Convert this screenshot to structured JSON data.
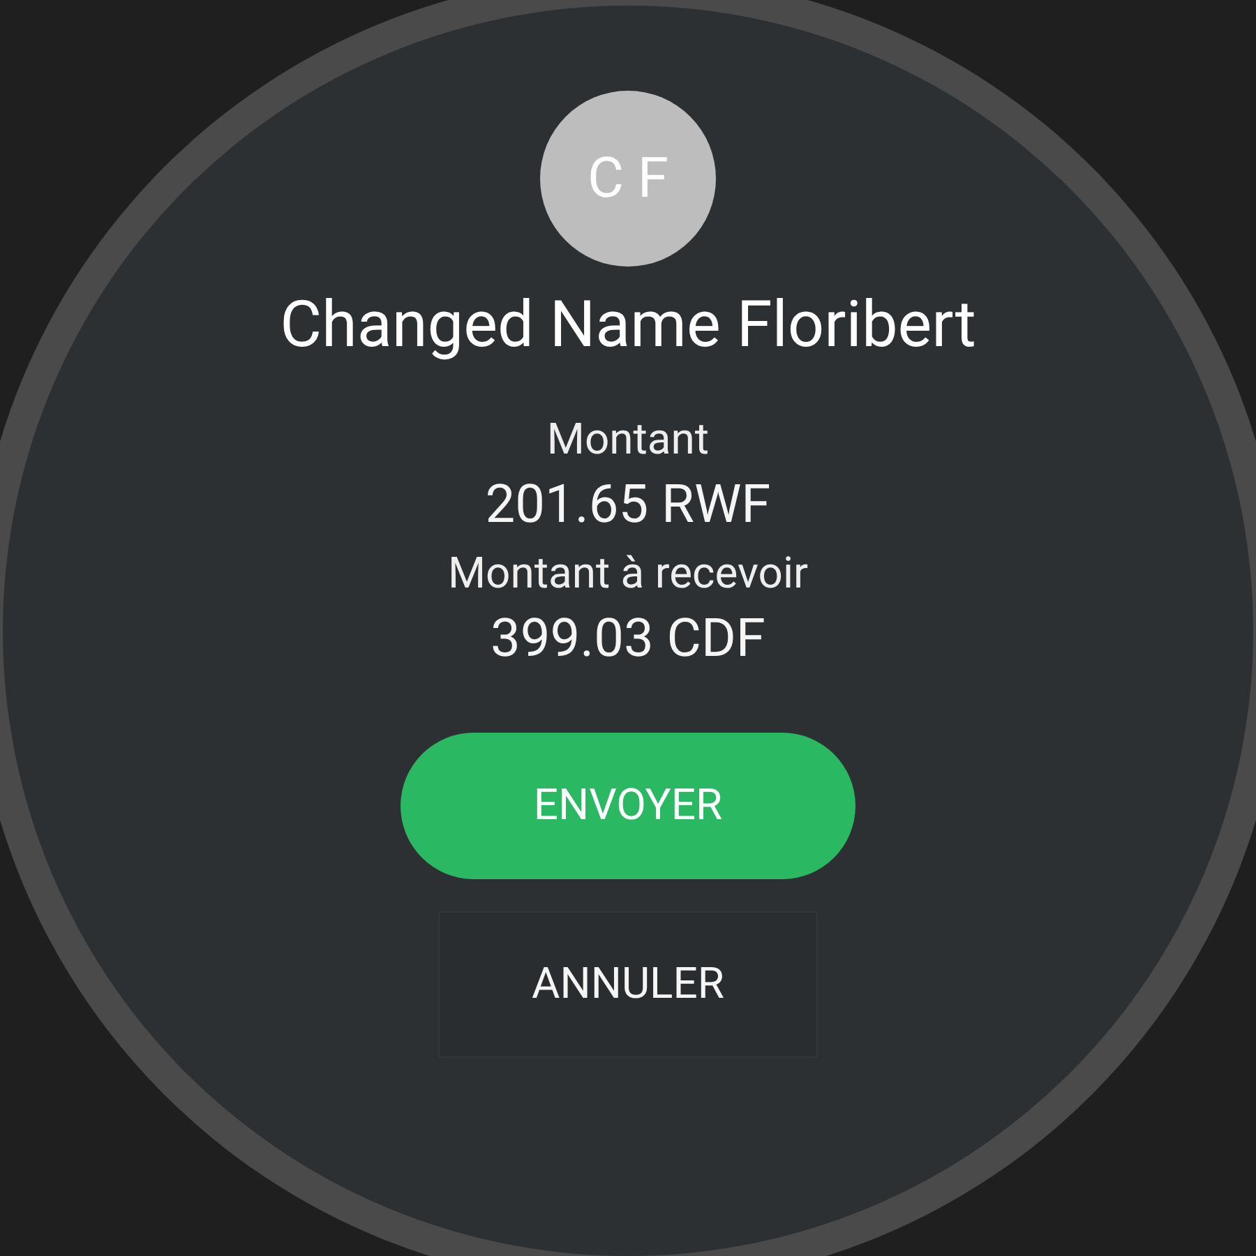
{
  "contact": {
    "initials": "C F",
    "name": "Changed Name Floribert"
  },
  "amounts": [
    {
      "label": "Montant",
      "value": "201.65 RWF"
    },
    {
      "label": "Montant à recevoir",
      "value": "399.03 CDF"
    }
  ],
  "buttons": [
    {
      "label": "ENVOYER",
      "kind": "primary"
    },
    {
      "label": "ANNULER",
      "kind": "secondary"
    }
  ]
}
